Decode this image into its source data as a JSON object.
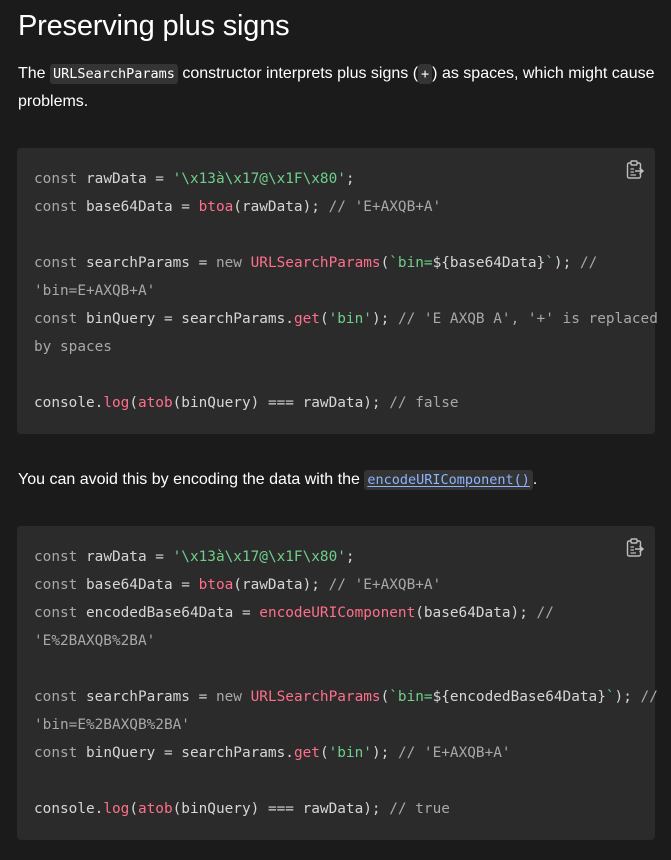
{
  "heading": "Preserving plus signs",
  "intro": {
    "t1": "The ",
    "code1": "URLSearchParams",
    "t2": " constructor interprets plus signs (",
    "code2": "+",
    "t3": ") as spaces, which might cause problems."
  },
  "middle": {
    "t1": "You can avoid this by encoding the data with the ",
    "link": "encodeURIComponent()",
    "t2": "."
  },
  "icons": {
    "copy": "clipboard-copy-icon"
  },
  "colors": {
    "background": "#1b1b1b",
    "code_background": "#2b2b2b",
    "string": "#6fcf8a",
    "function": "#ff6f8a",
    "comment": "#a7a8ab",
    "link": "#8cb4ff"
  },
  "code1": [
    [
      [
        "kw",
        "const"
      ],
      [
        "pl",
        " rawData = "
      ],
      [
        "str",
        "'\\x13à\\x17@\\x1F\\x80'"
      ],
      [
        "pl",
        ";"
      ]
    ],
    [
      [
        "kw",
        "const"
      ],
      [
        "pl",
        " base64Data = "
      ],
      [
        "fn",
        "btoa"
      ],
      [
        "pl",
        "(rawData); "
      ],
      [
        "cmt",
        "// 'E+AXQB+A'"
      ]
    ],
    [],
    [
      [
        "kw",
        "const"
      ],
      [
        "pl",
        " searchParams = "
      ],
      [
        "kw",
        "new"
      ],
      [
        "pl",
        " "
      ],
      [
        "fn",
        "URLSearchParams"
      ],
      [
        "pl",
        "("
      ],
      [
        "str",
        "`bin="
      ],
      [
        "pl",
        "${base64Data}"
      ],
      [
        "str",
        "`"
      ],
      [
        "pl",
        "); "
      ],
      [
        "cmt",
        "//"
      ]
    ],
    [
      [
        "cmt",
        "'bin=E+AXQB+A'"
      ]
    ],
    [
      [
        "kw",
        "const"
      ],
      [
        "pl",
        " binQuery = searchParams."
      ],
      [
        "fn",
        "get"
      ],
      [
        "pl",
        "("
      ],
      [
        "str",
        "'bin'"
      ],
      [
        "pl",
        "); "
      ],
      [
        "cmt",
        "// 'E AXQB A', '+' is replaced"
      ]
    ],
    [
      [
        "cmt",
        "by spaces"
      ]
    ],
    [],
    [
      [
        "pl",
        "console."
      ],
      [
        "fn",
        "log"
      ],
      [
        "pl",
        "("
      ],
      [
        "fn",
        "atob"
      ],
      [
        "pl",
        "(binQuery) === rawData); "
      ],
      [
        "cmt",
        "// false"
      ]
    ]
  ],
  "code2": [
    [
      [
        "kw",
        "const"
      ],
      [
        "pl",
        " rawData = "
      ],
      [
        "str",
        "'\\x13à\\x17@\\x1F\\x80'"
      ],
      [
        "pl",
        ";"
      ]
    ],
    [
      [
        "kw",
        "const"
      ],
      [
        "pl",
        " base64Data = "
      ],
      [
        "fn",
        "btoa"
      ],
      [
        "pl",
        "(rawData); "
      ],
      [
        "cmt",
        "// 'E+AXQB+A'"
      ]
    ],
    [
      [
        "kw",
        "const"
      ],
      [
        "pl",
        " encodedBase64Data = "
      ],
      [
        "fn",
        "encodeURIComponent"
      ],
      [
        "pl",
        "(base64Data); "
      ],
      [
        "cmt",
        "//"
      ]
    ],
    [
      [
        "cmt",
        "'E%2BAXQB%2BA'"
      ]
    ],
    [],
    [
      [
        "kw",
        "const"
      ],
      [
        "pl",
        " searchParams = "
      ],
      [
        "kw",
        "new"
      ],
      [
        "pl",
        " "
      ],
      [
        "fn",
        "URLSearchParams"
      ],
      [
        "pl",
        "("
      ],
      [
        "str",
        "`bin="
      ],
      [
        "pl",
        "${encodedBase64Data}"
      ],
      [
        "str",
        "`"
      ],
      [
        "pl",
        "); "
      ],
      [
        "cmt",
        "//"
      ]
    ],
    [
      [
        "cmt",
        "'bin=E%2BAXQB%2BA'"
      ]
    ],
    [
      [
        "kw",
        "const"
      ],
      [
        "pl",
        " binQuery = searchParams."
      ],
      [
        "fn",
        "get"
      ],
      [
        "pl",
        "("
      ],
      [
        "str",
        "'bin'"
      ],
      [
        "pl",
        "); "
      ],
      [
        "cmt",
        "// 'E+AXQB+A'"
      ]
    ],
    [],
    [
      [
        "pl",
        "console."
      ],
      [
        "fn",
        "log"
      ],
      [
        "pl",
        "("
      ],
      [
        "fn",
        "atob"
      ],
      [
        "pl",
        "(binQuery) === rawData); "
      ],
      [
        "cmt",
        "// true"
      ]
    ]
  ]
}
